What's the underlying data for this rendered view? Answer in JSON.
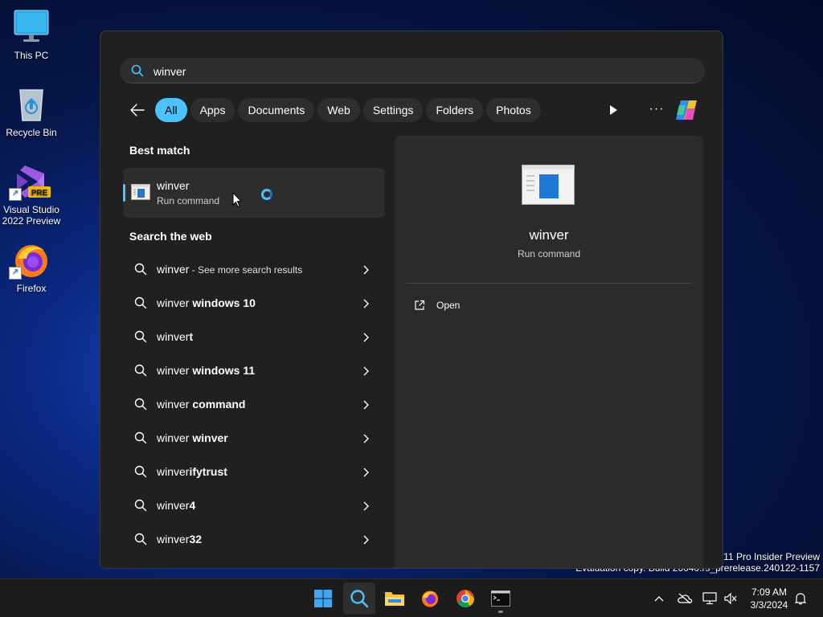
{
  "desktop": {
    "icons": [
      {
        "label": "This PC"
      },
      {
        "label": "Recycle Bin"
      },
      {
        "label": "Visual Studio 2022 Preview",
        "badge": "PRE"
      },
      {
        "label": "Firefox"
      }
    ]
  },
  "search": {
    "query": "winver",
    "filters": [
      {
        "label": "All",
        "active": true
      },
      {
        "label": "Apps"
      },
      {
        "label": "Documents"
      },
      {
        "label": "Web"
      },
      {
        "label": "Settings"
      },
      {
        "label": "Folders"
      },
      {
        "label": "Photos"
      }
    ],
    "more_label": "···"
  },
  "best_match": {
    "section_title": "Best match",
    "name": "winver",
    "subtitle": "Run command"
  },
  "web": {
    "section_title": "Search the web",
    "items": [
      {
        "prefix": "winver",
        "bold": "",
        "hint": " - See more search results"
      },
      {
        "prefix": "winver",
        "bold": " windows 10",
        "hint": ""
      },
      {
        "prefix": "winver",
        "bold": "t",
        "hint": ""
      },
      {
        "prefix": "winver",
        "bold": " windows 11",
        "hint": ""
      },
      {
        "prefix": "winver",
        "bold": " command",
        "hint": ""
      },
      {
        "prefix": "winver",
        "bold": " winver",
        "hint": ""
      },
      {
        "prefix": "winver",
        "bold": "ifytrust",
        "hint": ""
      },
      {
        "prefix": "winver",
        "bold": "4",
        "hint": ""
      },
      {
        "prefix": "winver",
        "bold": "32",
        "hint": ""
      }
    ]
  },
  "detail": {
    "name": "winver",
    "subtitle": "Run command",
    "open_label": "Open"
  },
  "watermark": {
    "line1": "s 11 Pro Insider Preview",
    "line2": "Evaluation copy. Build 26040.rs_prerelease.240122-1157"
  },
  "taskbar": {
    "time": "7:09 AM",
    "date": "3/3/2024"
  },
  "colors": {
    "accent": "#4cc2ff",
    "panel": "#202020"
  }
}
